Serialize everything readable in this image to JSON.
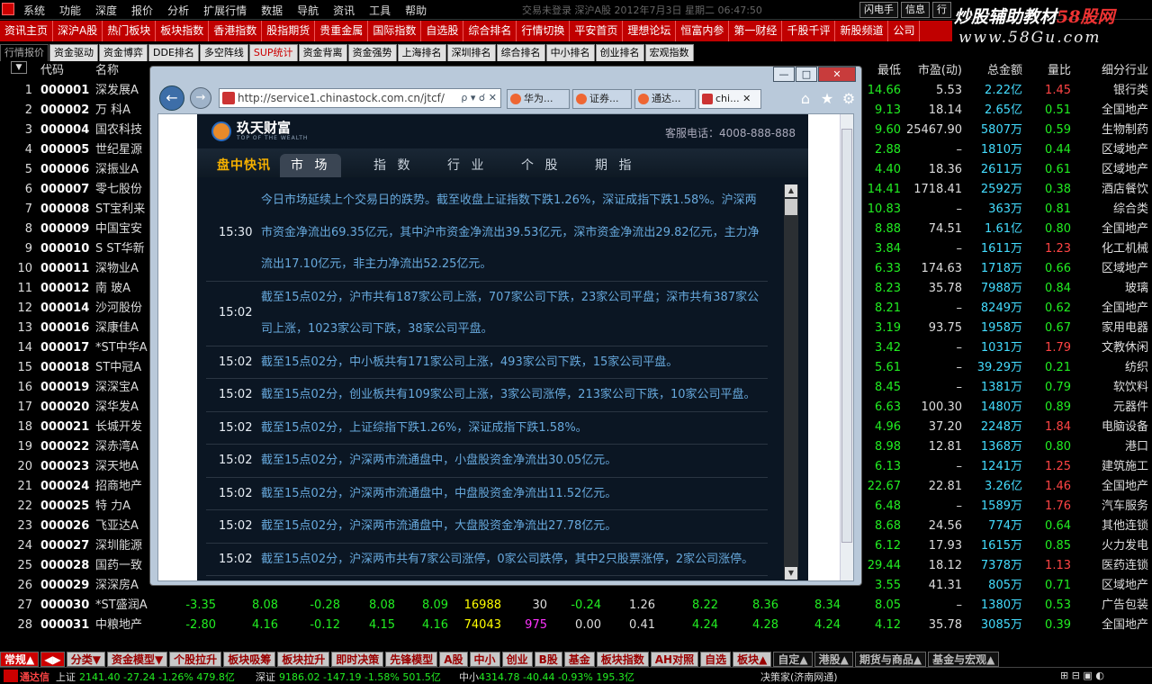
{
  "menu": [
    "系统",
    "功能",
    "深度",
    "报价",
    "分析",
    "扩展行情",
    "数据",
    "导航",
    "资讯",
    "工具",
    "帮助"
  ],
  "status_line": "交易未登录   深沪A股  2012年7月3日 星期二 06:47:50",
  "top_right_buttons": [
    "闪电手",
    "信息",
    "行"
  ],
  "watermark": {
    "title_a": "炒股辅助教材",
    "title_b": "58股网",
    "url": "www.58Gu.com"
  },
  "rednav": [
    "资讯主页",
    "深沪A股",
    "热门板块",
    "板块指数",
    "香港指数",
    "股指期货",
    "贵重金属",
    "国际指数",
    "自选股",
    "综合排名",
    "行情切换",
    "平安首页",
    "理想论坛",
    "恒富内参",
    "第一财经",
    "千股千评",
    "新股频道",
    "公司"
  ],
  "tabs": [
    "行情报价",
    "资金驱动",
    "资金博弈",
    "DDE排名",
    "多空阵线",
    "SUP统计",
    "资金背离",
    "资金强势",
    "上海排名",
    "深圳排名",
    "综合排名",
    "中小排名",
    "创业排名",
    "宏观指数"
  ],
  "selected_tab": "SUP统计",
  "header": {
    "arrow": "▼",
    "code": "代码",
    "name": "名称",
    "last": "最低",
    "pe": "市盈(动)",
    "amount": "总金额",
    "ratio": "量比",
    "industry": "细分行业"
  },
  "rows": [
    {
      "i": "1",
      "code": "000001",
      "name": "深发展A",
      "last": "14.66",
      "pe": "5.53",
      "amt": "2.22亿",
      "ratio": "1.45",
      "rr": true,
      "ind": "银行类"
    },
    {
      "i": "2",
      "code": "000002",
      "name": "万  科A",
      "last": "9.13",
      "pe": "18.14",
      "amt": "2.65亿",
      "ratio": "0.51",
      "ind": "全国地产"
    },
    {
      "i": "3",
      "code": "000004",
      "name": "国农科技",
      "last": "9.60",
      "pe": "25467.90",
      "amt": "5807万",
      "ratio": "0.59",
      "ind": "生物制药"
    },
    {
      "i": "4",
      "code": "000005",
      "name": "世纪星源",
      "last": "2.88",
      "pe": "–",
      "amt": "1810万",
      "ratio": "0.44",
      "ind": "区域地产"
    },
    {
      "i": "5",
      "code": "000006",
      "name": "深振业A",
      "last": "4.40",
      "pe": "18.36",
      "amt": "2611万",
      "ratio": "0.61",
      "ind": "区域地产"
    },
    {
      "i": "6",
      "code": "000007",
      "name": "零七股份",
      "last": "14.41",
      "pe": "1718.41",
      "amt": "2592万",
      "ratio": "0.38",
      "ind": "酒店餐饮"
    },
    {
      "i": "7",
      "code": "000008",
      "name": "ST宝利来",
      "last": "10.83",
      "pe": "–",
      "amt": "363万",
      "ratio": "0.81",
      "ind": "综合类"
    },
    {
      "i": "8",
      "code": "000009",
      "name": "中国宝安",
      "last": "8.88",
      "pe": "74.51",
      "amt": "1.61亿",
      "ratio": "0.80",
      "ind": "全国地产"
    },
    {
      "i": "9",
      "code": "000010",
      "name": "S ST华新",
      "last": "3.84",
      "pe": "–",
      "amt": "1611万",
      "ratio": "1.23",
      "rr": true,
      "ind": "化工机械"
    },
    {
      "i": "10",
      "code": "000011",
      "name": "深物业A",
      "last": "6.33",
      "pe": "174.63",
      "amt": "1718万",
      "ratio": "0.66",
      "ind": "区域地产"
    },
    {
      "i": "11",
      "code": "000012",
      "name": "南  玻A",
      "last": "8.23",
      "pe": "35.78",
      "amt": "7988万",
      "ratio": "0.84",
      "ind": "玻璃"
    },
    {
      "i": "12",
      "code": "000014",
      "name": "沙河股份",
      "last": "8.21",
      "pe": "–",
      "amt": "8249万",
      "ratio": "0.62",
      "ind": "全国地产"
    },
    {
      "i": "13",
      "code": "000016",
      "name": "深康佳A",
      "last": "3.19",
      "pe": "93.75",
      "amt": "1958万",
      "ratio": "0.67",
      "ind": "家用电器"
    },
    {
      "i": "14",
      "code": "000017",
      "name": "*ST中华A",
      "last": "3.42",
      "pe": "–",
      "amt": "1031万",
      "ratio": "1.79",
      "rr": true,
      "ind": "文教休闲"
    },
    {
      "i": "15",
      "code": "000018",
      "name": "ST中冠A",
      "last": "5.61",
      "pe": "–",
      "amt": "39.29万",
      "ratio": "0.21",
      "ind": "纺织"
    },
    {
      "i": "16",
      "code": "000019",
      "name": "深深宝A",
      "last": "8.45",
      "pe": "–",
      "amt": "1381万",
      "ratio": "0.79",
      "ind": "软饮料"
    },
    {
      "i": "17",
      "code": "000020",
      "name": "深华发A",
      "last": "6.63",
      "pe": "100.30",
      "amt": "1480万",
      "ratio": "0.89",
      "ind": "元器件"
    },
    {
      "i": "18",
      "code": "000021",
      "name": "长城开发",
      "last": "4.96",
      "pe": "37.20",
      "amt": "2248万",
      "ratio": "1.84",
      "rr": true,
      "ind": "电脑设备"
    },
    {
      "i": "19",
      "code": "000022",
      "name": "深赤湾A",
      "last": "8.98",
      "pe": "12.81",
      "amt": "1368万",
      "ratio": "0.80",
      "ind": "港口"
    },
    {
      "i": "20",
      "code": "000023",
      "name": "深天地A",
      "last": "6.13",
      "pe": "–",
      "amt": "1241万",
      "ratio": "1.25",
      "rr": true,
      "ind": "建筑施工"
    },
    {
      "i": "21",
      "code": "000024",
      "name": "招商地产",
      "last": "22.67",
      "pe": "22.81",
      "amt": "3.26亿",
      "ratio": "1.46",
      "rr": true,
      "ind": "全国地产"
    },
    {
      "i": "22",
      "code": "000025",
      "name": "特  力A",
      "last": "6.48",
      "pe": "–",
      "amt": "1589万",
      "ratio": "1.76",
      "rr": true,
      "ind": "汽车服务"
    },
    {
      "i": "23",
      "code": "000026",
      "name": "飞亚达A",
      "last": "8.68",
      "pe": "24.56",
      "amt": "774万",
      "ratio": "0.64",
      "ind": "其他连锁"
    },
    {
      "i": "24",
      "code": "000027",
      "name": "深圳能源",
      "last": "6.12",
      "pe": "17.93",
      "amt": "1615万",
      "ratio": "0.85",
      "ind": "火力发电"
    },
    {
      "i": "25",
      "code": "000028",
      "name": "国药一致",
      "last": "29.44",
      "pe": "18.12",
      "amt": "7378万",
      "ratio": "1.13",
      "rr": true,
      "ind": "医药连锁"
    },
    {
      "i": "26",
      "code": "000029",
      "name": "深深房A",
      "last": "3.55",
      "pe": "41.31",
      "amt": "805万",
      "ratio": "0.71",
      "ind": "区域地产"
    },
    {
      "i": "27",
      "code": "000030",
      "name": "*ST盛润A",
      "chg": "-3.35",
      "open": "8.08",
      "d": "-0.28",
      "hi": "8.08",
      "lo": "8.09",
      "vol": "16988",
      "cur": "30",
      "spd": "-0.24",
      "to": "1.26",
      "b1": "8.22",
      "b2": "8.36",
      "b3": "8.34",
      "last": "8.05",
      "pe": "–",
      "amt": "1380万",
      "ratio": "0.53",
      "ind": "广告包装"
    },
    {
      "i": "28",
      "code": "000031",
      "name": "中粮地产",
      "chg": "-2.80",
      "open": "4.16",
      "d": "-0.12",
      "hi": "4.15",
      "lo": "4.16",
      "vol": "74043",
      "cur": "975",
      "spd": "0.00",
      "to": "0.41",
      "b1": "4.24",
      "b2": "4.28",
      "b3": "4.24",
      "last": "4.12",
      "pe": "35.78",
      "amt": "3085万",
      "ratio": "0.39",
      "ind": "全国地产"
    }
  ],
  "bottom_tabs": [
    "常规▲",
    "分类▼",
    "资金模型▼",
    "个股拉升",
    "板块吸筹",
    "板块拉升",
    "即时决策",
    "先锋模型",
    "A股",
    "中小",
    "创业",
    "B股",
    "基金",
    "板块指数",
    "AH对照",
    "自选",
    "板块▲",
    "自定▲",
    "港股▲",
    "期货与商品▲",
    "基金与宏观▲"
  ],
  "statusbar": {
    "brand": "通达信",
    "sh_label": "上证",
    "sh": "2141.40 -27.24 -1.26% 479.8亿",
    "sz_label": "深证",
    "sz": "9186.02 -147.19 -1.58% 501.5亿",
    "zx_label": "中小",
    "zx": "4314.78 -40.44 -0.93% 195.3亿",
    "site": "决策家(济南网通)"
  },
  "browser": {
    "url": "http://service1.chinastock.com.cn/jtcf/",
    "url_tools": "ρ ▾ ☌ ✕",
    "tabs": [
      "华为...",
      "证券...",
      "通达...",
      "chi..."
    ],
    "controls": [
      "—",
      "□",
      "✕"
    ],
    "toolbar_icons": [
      "⌂",
      "★",
      "⚙"
    ]
  },
  "site": {
    "logo": "玖天财富",
    "logo_sub": "TOP OF THE WEALTH",
    "hotline": "客服电话：4008-888-888",
    "tabs": [
      "盘中快讯",
      "市 场",
      "指 数",
      "行 业",
      "个 股",
      "期 指"
    ],
    "active_tab": "市 场",
    "feed": [
      {
        "time": "15:30",
        "text": "今日市场延续上个交易日的跌势。截至收盘上证指数下跌1.26%，深证成指下跌1.58%。沪深两市资金净流出69.35亿元，其中沪市资金净流出39.53亿元，深市资金净流出29.82亿元，主力净流出17.10亿元，非主力净流出52.25亿元。"
      },
      {
        "time": "15:02",
        "text": "截至15点02分，沪市共有187家公司上涨，707家公司下跌，23家公司平盘；深市共有387家公司上涨，1023家公司下跌，38家公司平盘。"
      },
      {
        "time": "15:02",
        "text": "截至15点02分，中小板共有171家公司上涨，493家公司下跌，15家公司平盘。"
      },
      {
        "time": "15:02",
        "text": "截至15点02分，创业板共有109家公司上涨，3家公司涨停，213家公司下跌，10家公司平盘。"
      },
      {
        "time": "15:02",
        "text": "截至15点02分，上证综指下跌1.26%，深证成指下跌1.58%。"
      },
      {
        "time": "15:02",
        "text": "截至15点02分，沪深两市流通盘中，小盘股资金净流出30.05亿元。"
      },
      {
        "time": "15:02",
        "text": "截至15点02分，沪深两市流通盘中，中盘股资金净流出11.52亿元。"
      },
      {
        "time": "15:02",
        "text": "截至15点02分，沪深两市流通盘中，大盘股资金净流出27.78亿元。"
      },
      {
        "time": "15:02",
        "text": "截至15点02分，沪深两市共有7家公司涨停，0家公司跌停，其中2只股票涨停，2家公司涨停。"
      }
    ]
  },
  "colors": {
    "red_nav": "#c00000",
    "up": "#f44",
    "down": "#2e2",
    "amount": "#4df",
    "feed_text": "#67a9dd",
    "site_bg": "#0b1623",
    "active_site_tab": "#f5b000"
  }
}
